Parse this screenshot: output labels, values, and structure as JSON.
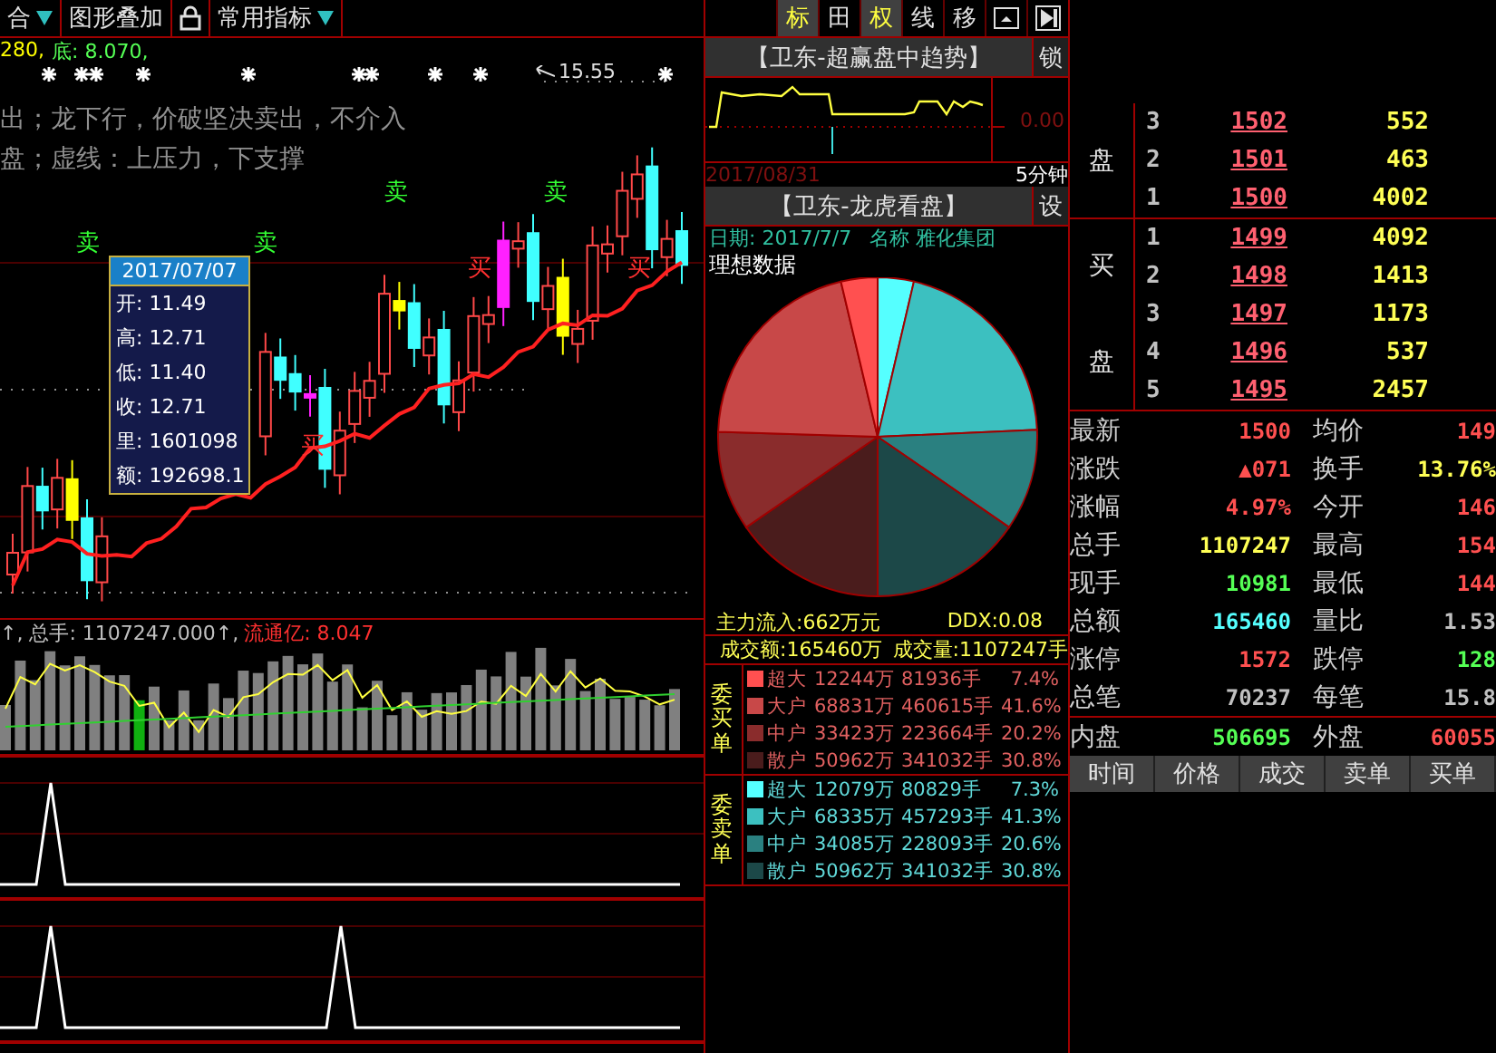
{
  "toolbar": [
    {
      "label": "合",
      "dropdown": true
    },
    {
      "label": "图形叠加",
      "dropdown": false
    },
    {
      "label": "常用指标",
      "dropdown": true
    }
  ],
  "main_chart": {
    "top_value": "280,",
    "bottom_value": "底: 8.070,",
    "high_label": "15.55",
    "notes": [
      "出；龙下行，价破坚决卖出，不介入",
      "盘；虚线：上压力，下支撑"
    ],
    "signals": [
      {
        "kind": "sell",
        "label": "卖"
      },
      {
        "kind": "sell",
        "label": "卖"
      },
      {
        "kind": "sell",
        "label": "卖"
      },
      {
        "kind": "sell",
        "label": "卖"
      },
      {
        "kind": "buy",
        "label": "买"
      },
      {
        "kind": "buy",
        "label": "买"
      },
      {
        "kind": "buy",
        "label": "买"
      }
    ],
    "tooltip": {
      "date": "2017/07/07",
      "rows": [
        "开: 11.49",
        "高: 12.71",
        "低: 11.40",
        "收: 12.71",
        "里: 1601098",
        "额: 192698.1"
      ]
    }
  },
  "volume_pane": {
    "total": "↑, 总手: 1107247.000↑,",
    "float": "流通亿: 8.047"
  },
  "middle_toolbar": [
    {
      "label": "标",
      "selected": true
    },
    {
      "label": "田",
      "selected": false
    },
    {
      "label": "权",
      "selected": true
    },
    {
      "label": "线",
      "selected": false
    },
    {
      "label": "移",
      "selected": false
    }
  ],
  "trend_panel": {
    "title": "【卫东-超赢盘中趋势】",
    "button": "锁",
    "value_label": "0.00",
    "date": "2017/08/31",
    "period": "5分钟"
  },
  "dragon_panel": {
    "title": "【卫东-龙虎看盘】",
    "button": "设",
    "date_label": "日期: 2017/7/7",
    "name_label": "名称 雅化集团",
    "subtitle": "理想数据",
    "main_inflow": "主力流入:662万元",
    "ddx": "DDX:0.08",
    "turnover": "成交额:165460万",
    "volume": "成交量:1107247手",
    "groups": [
      {
        "kind": "buy",
        "label": "委买单",
        "rows": [
          {
            "name": "超大",
            "amount": "12244万",
            "shares": "81936手",
            "pct": "7.4%",
            "color": "#ff5050"
          },
          {
            "name": "大户",
            "amount": "68831万",
            "shares": "460615手",
            "pct": "41.6%",
            "color": "#c84848"
          },
          {
            "name": "中户",
            "amount": "33423万",
            "shares": "223664手",
            "pct": "20.2%",
            "color": "#8a2c2c"
          },
          {
            "name": "散户",
            "amount": "50962万",
            "shares": "341032手",
            "pct": "30.8%",
            "color": "#4a1c1c"
          }
        ]
      },
      {
        "kind": "sell",
        "label": "委卖单",
        "rows": [
          {
            "name": "超大",
            "amount": "12079万",
            "shares": "80829手",
            "pct": "7.3%",
            "color": "#55ffff"
          },
          {
            "name": "大户",
            "amount": "68335万",
            "shares": "457293手",
            "pct": "41.3%",
            "color": "#3cc0c0"
          },
          {
            "name": "中户",
            "amount": "34085万",
            "shares": "228093手",
            "pct": "20.6%",
            "color": "#2a8080"
          },
          {
            "name": "散户",
            "amount": "50962万",
            "shares": "341032手",
            "pct": "30.8%",
            "color": "#1c4848"
          }
        ]
      }
    ]
  },
  "order_book": {
    "sell": {
      "labels": [
        "盘"
      ],
      "rows": [
        {
          "rank": "3",
          "price": "1502",
          "volume": "552"
        },
        {
          "rank": "2",
          "price": "1501",
          "volume": "463"
        },
        {
          "rank": "1",
          "price": "1500",
          "volume": "4002"
        }
      ]
    },
    "buy": {
      "labels": [
        "买",
        "盘"
      ],
      "rows": [
        {
          "rank": "1",
          "price": "1499",
          "volume": "4092"
        },
        {
          "rank": "2",
          "price": "1498",
          "volume": "1413"
        },
        {
          "rank": "3",
          "price": "1497",
          "volume": "1173"
        },
        {
          "rank": "4",
          "price": "1496",
          "volume": "537"
        },
        {
          "rank": "5",
          "price": "1495",
          "volume": "2457"
        }
      ]
    }
  },
  "stats": [
    [
      {
        "label": "最新",
        "value": "1500",
        "color": "#ff5050"
      },
      {
        "label": "均价",
        "value": "149",
        "color": "#ff5050"
      }
    ],
    [
      {
        "label": "涨跌",
        "value": "▲071",
        "color": "#ff5050"
      },
      {
        "label": "换手",
        "value": "13.76%",
        "color": "#ffff55"
      }
    ],
    [
      {
        "label": "涨幅",
        "value": "4.97%",
        "color": "#ff5050"
      },
      {
        "label": "今开",
        "value": "146",
        "color": "#ff5050"
      }
    ],
    [
      {
        "label": "总手",
        "value": "1107247",
        "color": "#ffff55"
      },
      {
        "label": "最高",
        "value": "154",
        "color": "#ff5050"
      }
    ],
    [
      {
        "label": "现手",
        "value": "10981",
        "color": "#55ff55"
      },
      {
        "label": "最低",
        "value": "144",
        "color": "#ff5050"
      }
    ],
    [
      {
        "label": "总额",
        "value": "165460",
        "color": "#55ffff"
      },
      {
        "label": "量比",
        "value": "1.53",
        "color": "#c0c0c0"
      }
    ],
    [
      {
        "label": "涨停",
        "value": "1572",
        "color": "#ff5050"
      },
      {
        "label": "跌停",
        "value": "128",
        "color": "#55ff55"
      }
    ],
    [
      {
        "label": "总笔",
        "value": "70237",
        "color": "#c0c0c0"
      },
      {
        "label": "每笔",
        "value": "15.8",
        "color": "#c0c0c0"
      }
    ]
  ],
  "inner_outer": [
    {
      "label": "内盘",
      "value": "506695",
      "color": "#55ff55"
    },
    {
      "label": "外盘",
      "value": "60055",
      "color": "#ff5050"
    }
  ],
  "bottom_tabs": [
    "时间",
    "价格",
    "成交",
    "卖单",
    "买单"
  ]
}
